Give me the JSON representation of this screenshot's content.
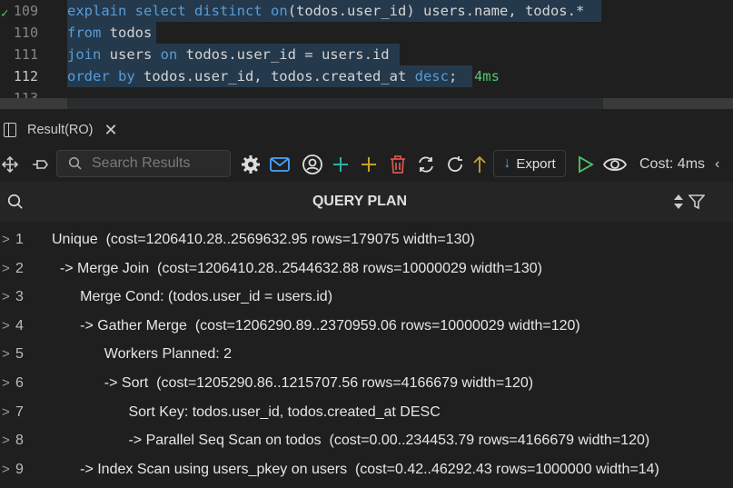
{
  "editor": {
    "lines": [
      {
        "num": "109",
        "tokens": [
          {
            "t": "explain",
            "c": "kw"
          },
          {
            "t": " ",
            "c": "id"
          },
          {
            "t": "select",
            "c": "kw"
          },
          {
            "t": " ",
            "c": "id"
          },
          {
            "t": "distinct",
            "c": "kw"
          },
          {
            "t": " ",
            "c": "id"
          },
          {
            "t": "on",
            "c": "kw"
          },
          {
            "t": "(todos.user_id) users.name, todos.*",
            "c": "id"
          }
        ]
      },
      {
        "num": "110",
        "tokens": [
          {
            "t": "from",
            "c": "kw"
          },
          {
            "t": " todos",
            "c": "id"
          }
        ]
      },
      {
        "num": "111",
        "tokens": [
          {
            "t": "join",
            "c": "kw"
          },
          {
            "t": " users ",
            "c": "id"
          },
          {
            "t": "on",
            "c": "kw"
          },
          {
            "t": " todos.user_id = users.id",
            "c": "id"
          }
        ]
      },
      {
        "num": "112",
        "tokens": [
          {
            "t": "order by",
            "c": "kw"
          },
          {
            "t": " todos.user_id, todos.created_at ",
            "c": "id"
          },
          {
            "t": "desc",
            "c": "kw"
          },
          {
            "t": ";",
            "c": "id"
          }
        ]
      },
      {
        "num": "113",
        "tokens": []
      }
    ],
    "execution_time": "4ms",
    "colors": {
      "keyword": "#569cd6",
      "identifier": "#d4d4d4",
      "success": "#4ec96b"
    }
  },
  "panel": {
    "tab_label": "Result(RO)",
    "search_placeholder": "Search Results",
    "export_label": "Export",
    "cost_label": "Cost: 4ms"
  },
  "grid": {
    "column": "QUERY PLAN",
    "rows": [
      {
        "n": "1",
        "text": "Unique  (cost=1206410.28..2569632.95 rows=179075 width=130)"
      },
      {
        "n": "2",
        "text": "  -> Merge Join  (cost=1206410.28..2544632.88 rows=10000029 width=130)"
      },
      {
        "n": "3",
        "text": "       Merge Cond: (todos.user_id = users.id)"
      },
      {
        "n": "4",
        "text": "       -> Gather Merge  (cost=1206290.89..2370959.06 rows=10000029 width=120)"
      },
      {
        "n": "5",
        "text": "             Workers Planned: 2"
      },
      {
        "n": "6",
        "text": "             -> Sort  (cost=1205290.86..1215707.56 rows=4166679 width=120)"
      },
      {
        "n": "7",
        "text": "                   Sort Key: todos.user_id, todos.created_at DESC"
      },
      {
        "n": "8",
        "text": "                   -> Parallel Seq Scan on todos  (cost=0.00..234453.79 rows=4166679 width=120)"
      },
      {
        "n": "9",
        "text": "       -> Index Scan using users_pkey on users  (cost=0.42..46292.43 rows=1000000 width=14)"
      }
    ]
  }
}
